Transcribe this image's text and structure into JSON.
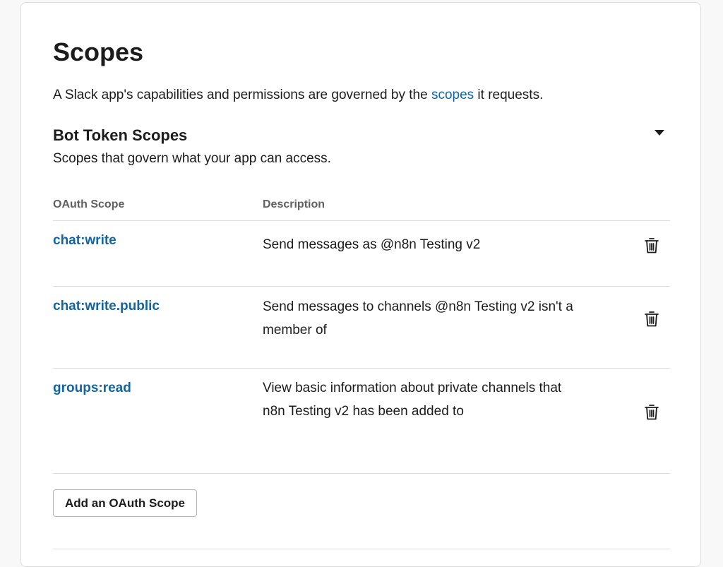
{
  "scopes_section": {
    "title": "Scopes",
    "intro_before": "A Slack app's capabilities and permissions are governed by the ",
    "intro_link": "scopes",
    "intro_after": " it requests."
  },
  "bot_token": {
    "title": "Bot Token Scopes",
    "subtitle": "Scopes that govern what your app can access.",
    "collapse_icon": "caret-down-icon"
  },
  "table": {
    "col_scope": "OAuth Scope",
    "col_description": "Description",
    "rows": [
      {
        "scope": "chat:write",
        "description": "Send messages as @n8n Testing v2",
        "action_icon": "trash-icon"
      },
      {
        "scope": "chat:write.public",
        "description": "Send messages to channels @n8n Testing v2 isn't a member of",
        "action_icon": "trash-icon"
      },
      {
        "scope": "groups:read",
        "description": "View basic information about private channels that n8n Testing v2 has been added to",
        "action_icon": "trash-icon"
      }
    ]
  },
  "add_button": {
    "label": "Add an OAuth Scope"
  },
  "colors": {
    "link": "#1264a3",
    "text": "#1d1c1d",
    "muted": "#616061",
    "divider": "#dddddd"
  }
}
